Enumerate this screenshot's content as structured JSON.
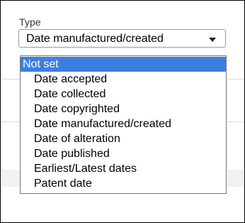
{
  "field": {
    "label": "Type",
    "selected_value": "Date manufactured/created"
  },
  "dropdown": {
    "highlighted_option": "Not set",
    "options": [
      "Not set",
      "Date accepted",
      "Date collected",
      "Date copyrighted",
      "Date manufactured/created",
      "Date of alteration",
      "Date published",
      "Earliest/Latest dates",
      "Patent date"
    ]
  },
  "colors": {
    "highlight": "#3b7fe0",
    "border": "#767676"
  },
  "icons": {
    "select_caret": "chevron-down-icon"
  }
}
